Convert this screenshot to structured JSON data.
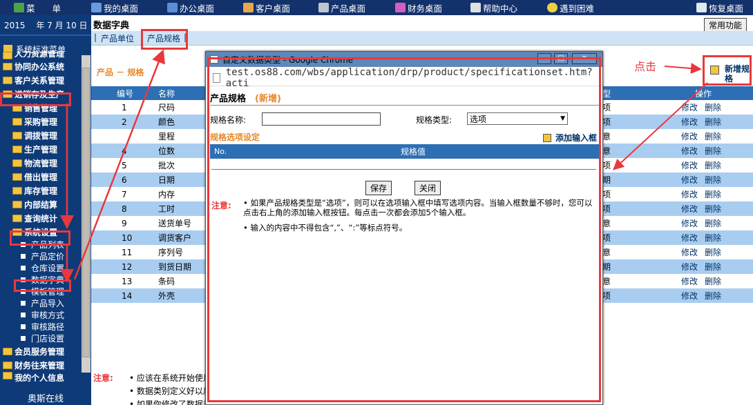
{
  "topnav": [
    {
      "label": "菜　　单",
      "icon": "menu-icon"
    },
    {
      "label": "我的桌面",
      "icon": "desktop-icon"
    },
    {
      "label": "办公桌面",
      "icon": "chart-icon"
    },
    {
      "label": "客户桌面",
      "icon": "customer-icon"
    },
    {
      "label": "产品桌面",
      "icon": "cart-icon"
    },
    {
      "label": "财务桌面",
      "icon": "finance-icon"
    },
    {
      "label": "帮助中心",
      "icon": "book-icon"
    },
    {
      "label": "遇到困难",
      "icon": "penguin-icon"
    },
    {
      "label": "恢复桌面",
      "icon": "window-icon"
    }
  ],
  "sidebar": {
    "date": "2015 　年 7 月 10 日",
    "title": "系统标准菜单",
    "items": [
      "人力资源管理",
      "协同办公系统",
      "客户关系管理",
      "进销存及生产",
      "销售管理",
      "采购管理",
      "调拨管理",
      "生产管理",
      "物流管理",
      "借出管理",
      "库存管理",
      "内部结算",
      "查询统计",
      "系统设置"
    ],
    "sub_items": [
      "产品列表",
      "产品定价",
      "仓库设置",
      "数据字典",
      "模板管理",
      "产品导入",
      "审核方式",
      "审核路径",
      "门店设置"
    ],
    "bottom_items": [
      "会员服务管理",
      "财务往来管理",
      "我的个人信息"
    ],
    "footer": "奥斯在线"
  },
  "main": {
    "title": "数据字典",
    "common_button": "常用功能",
    "tabs": [
      "产品单位",
      "产品规格"
    ],
    "section_title": "产品 － 规格",
    "new_button": "新增规格",
    "columns": {
      "no": "编号",
      "name": "名称",
      "type": "型",
      "ops": "操作"
    },
    "rows": [
      {
        "no": "1",
        "name": "尺码",
        "type": "项"
      },
      {
        "no": "2",
        "name": "颜色",
        "type": "项"
      },
      {
        "no": "",
        "name": "里程",
        "type": "意"
      },
      {
        "no": "4",
        "name": "位数",
        "type": "意"
      },
      {
        "no": "5",
        "name": "批次",
        "type": "项"
      },
      {
        "no": "6",
        "name": "日期",
        "type": "期"
      },
      {
        "no": "7",
        "name": "内存",
        "type": "项"
      },
      {
        "no": "8",
        "name": "工时",
        "type": "项"
      },
      {
        "no": "9",
        "name": "送货单号",
        "type": "意"
      },
      {
        "no": "10",
        "name": "调货客户",
        "type": "项"
      },
      {
        "no": "11",
        "name": "序列号",
        "type": "意"
      },
      {
        "no": "12",
        "name": "到货日期",
        "type": "期"
      },
      {
        "no": "13",
        "name": "条码",
        "type": "意"
      },
      {
        "no": "14",
        "name": "外壳",
        "type": "项"
      }
    ],
    "edit_label": "修改",
    "delete_label": "删除",
    "note_label": "注意:",
    "notes": [
      "• 应该在系统开始使用",
      "• 数据类别定义好以后",
      "• 如果你修改了数据类"
    ]
  },
  "modal": {
    "title": "自定义数据类型 - Google Chrome",
    "url": "test.os88.com/wbs/application/drp/product/specificationset.htm?acti",
    "heading": "产品规格",
    "heading_tag": "(新增)",
    "name_label": "规格名称:",
    "name_value": "",
    "type_label": "规格类型:",
    "type_value": "选项",
    "options_title": "规格选项设定",
    "add_input": "添加输入框",
    "col_no": "No.",
    "col_value": "规格值",
    "save": "保存",
    "close": "关闭",
    "note_label": "注意:",
    "note1": "• 如果产品规格类型是“选项”，则可以在选项输入框中填写选项内容。当输入框数量不够时，您可以点击右上角的添加输入框按钮。每点击一次都会添加5个输入框。",
    "note2": "• 输入的内容中不得包含“,”、“:”等标点符号。"
  },
  "annotation": {
    "click_text": "点击"
  },
  "colors": {
    "accent_red": "#e9383b",
    "nav_blue": "#13316b",
    "row_alt": "#a9cdf0",
    "header_blue": "#2d6fb5"
  }
}
